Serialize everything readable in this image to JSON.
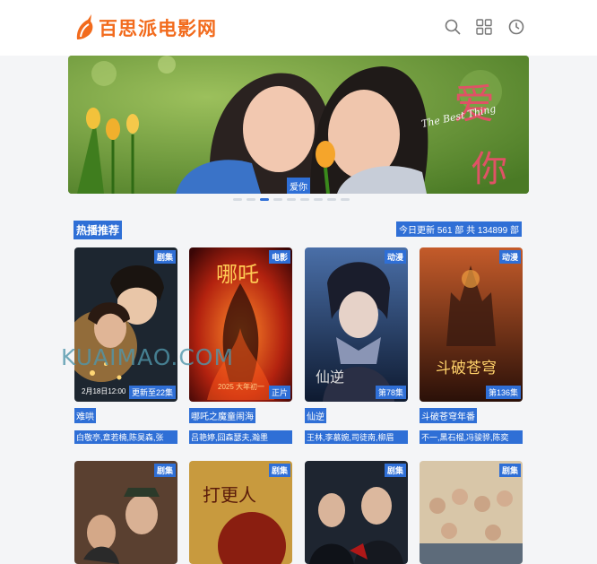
{
  "site": {
    "name": "百思派电影网"
  },
  "header_icons": [
    "search-icon",
    "grid-icon",
    "clock-icon"
  ],
  "banner": {
    "title": "爱你",
    "subtitle": "The Best Thing",
    "caption": "爱你",
    "dots_total": 9,
    "active_dot": 2
  },
  "hot": {
    "title": "热播推荐",
    "stats": "今日更新 561 部 共 134899 部"
  },
  "cards_row1": [
    {
      "title": "难哄",
      "actors": "白敬亭,章若楠,陈昊森,张",
      "badge": "剧集",
      "episode": "更新至22集",
      "date": "2月18日12:00"
    },
    {
      "title": "哪吒之魔童闹海",
      "actors": "吕艳婷,囧森瑟夫,瀚墨",
      "badge": "电影",
      "episode": "正片"
    },
    {
      "title": "仙逆",
      "actors": "王林,李慕婉,司徒南,柳眉",
      "badge": "动漫",
      "episode": "第78集"
    },
    {
      "title": "斗破苍穹年番",
      "actors": "不一,黑石榴,冯骏骅,陈奕",
      "badge": "动漫",
      "episode": "第136集"
    }
  ],
  "cards_row2": [
    {
      "badge": "剧集"
    },
    {
      "badge": "剧集"
    },
    {
      "badge": "剧集"
    },
    {
      "badge": "剧集"
    }
  ],
  "watermark": "KUAIMAO.COM",
  "colors": {
    "brand": "#f26b1d",
    "accent": "#2f6fd6"
  }
}
